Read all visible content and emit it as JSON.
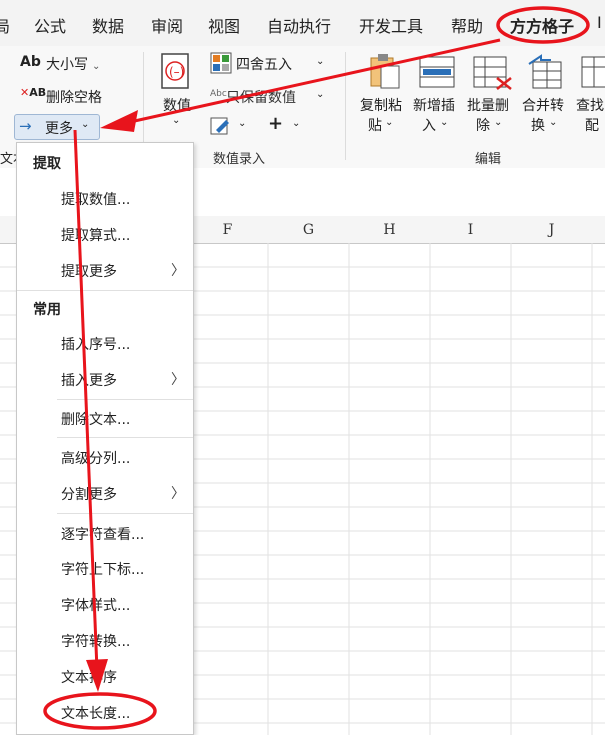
{
  "tabs": [
    "局",
    "公式",
    "数据",
    "审阅",
    "视图",
    "自动执行",
    "开发工具",
    "帮助",
    "方方格子",
    "Ⅰ"
  ],
  "ribbon": {
    "case_label": "大小写",
    "remove_spaces_label": "删除空格",
    "more_label": "更多",
    "text_group_fragment": "文本",
    "numbers_label_a": "数值",
    "round_label": "四舍五入",
    "keep_value_label": "只保留数值",
    "value_entry_group": "数值录入",
    "copy_paste_label": [
      "复制粘",
      "贴"
    ],
    "add_insert_label": [
      "新增插",
      "入"
    ],
    "batch_delete_label": [
      "批量删",
      "除"
    ],
    "merge_convert_label": [
      "合并转",
      "换"
    ],
    "find_match_label": [
      "查找",
      "配"
    ],
    "edit_group": "编辑"
  },
  "sheet": {
    "columns": [
      "F",
      "G",
      "H",
      "I",
      "J"
    ]
  },
  "menu": {
    "section_extract": "提取",
    "extract_items": [
      "提取数值...",
      "提取算式...",
      "提取更多"
    ],
    "section_common": "常用",
    "common_items": [
      "插入序号...",
      "插入更多",
      "删除文本...",
      "高级分列...",
      "分割更多",
      "逐字符查看...",
      "字符上下标...",
      "字体样式...",
      "字符转换...",
      "文本排序",
      "文本长度..."
    ]
  },
  "annotation_color": "#e8141c",
  "highlight_color": "#dfe9f5"
}
